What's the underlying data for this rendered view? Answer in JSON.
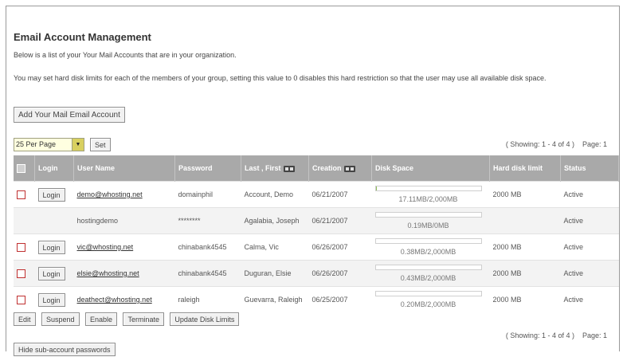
{
  "page": {
    "title": "Email Account Management",
    "intro": "Below is a list of your Your Mail Accounts that are in your organization.",
    "limits_text": "You may set hard disk limits for each of the members of your group, setting this value to 0 disables this hard restriction so that the user may use all available disk space."
  },
  "toolbar": {
    "add_button": "Add Your Mail Email Account",
    "per_page": "25 Per Page",
    "set_button": "Set",
    "showing": "( Showing: 1 - 4 of 4 )",
    "page_label": "Page: 1"
  },
  "table": {
    "headers": {
      "login": "Login",
      "user_name": "User Name",
      "password": "Password",
      "name": "Last , First",
      "creation": "Creation",
      "disk_space": "Disk Space",
      "limit": "Hard disk limit",
      "status": "Status"
    },
    "rows": [
      {
        "login": "Login",
        "user": "demo@whosting.net",
        "password": "domainphil",
        "name": "Account, Demo",
        "created": "06/21/2007",
        "disk": "17.11MB/2,000MB",
        "disk_fraction": 0.01,
        "limit": "2000 MB",
        "status": "Active"
      },
      {
        "login": "",
        "user": "hostingdemo",
        "password": "********",
        "name": "Agalabia, Joseph",
        "created": "06/21/2007",
        "disk": "0.19MB/0MB",
        "disk_fraction": 0.0,
        "limit": "",
        "status": "Active"
      },
      {
        "login": "Login",
        "user": "vic@whosting.net",
        "password": "chinabank4545",
        "name": "Calma, Vic",
        "created": "06/26/2007",
        "disk": "0.38MB/2,000MB",
        "disk_fraction": 0.0,
        "limit": "2000 MB",
        "status": "Active"
      },
      {
        "login": "Login",
        "user": "elsie@whosting.net",
        "password": "chinabank4545",
        "name": "Duguran, Elsie",
        "created": "06/26/2007",
        "disk": "0.43MB/2,000MB",
        "disk_fraction": 0.0,
        "limit": "2000 MB",
        "status": "Active"
      },
      {
        "login": "Login",
        "user": "deathect@whosting.net",
        "password": "raleigh",
        "name": "Guevarra, Raleigh",
        "created": "06/25/2007",
        "disk": "0.20MB/2,000MB",
        "disk_fraction": 0.0,
        "limit": "2000 MB",
        "status": "Active"
      }
    ]
  },
  "actions": {
    "edit": "Edit",
    "suspend": "Suspend",
    "enable": "Enable",
    "terminate": "Terminate",
    "update_limits": "Update Disk Limits",
    "hide_passwords": "Hide sub-account passwords"
  },
  "colors": {
    "header_bg": "#a9a9a9",
    "checkbox_border": "#c03030",
    "perpage_bg": "#ffffe0",
    "diskbar_fill": "#8fbc5a"
  }
}
